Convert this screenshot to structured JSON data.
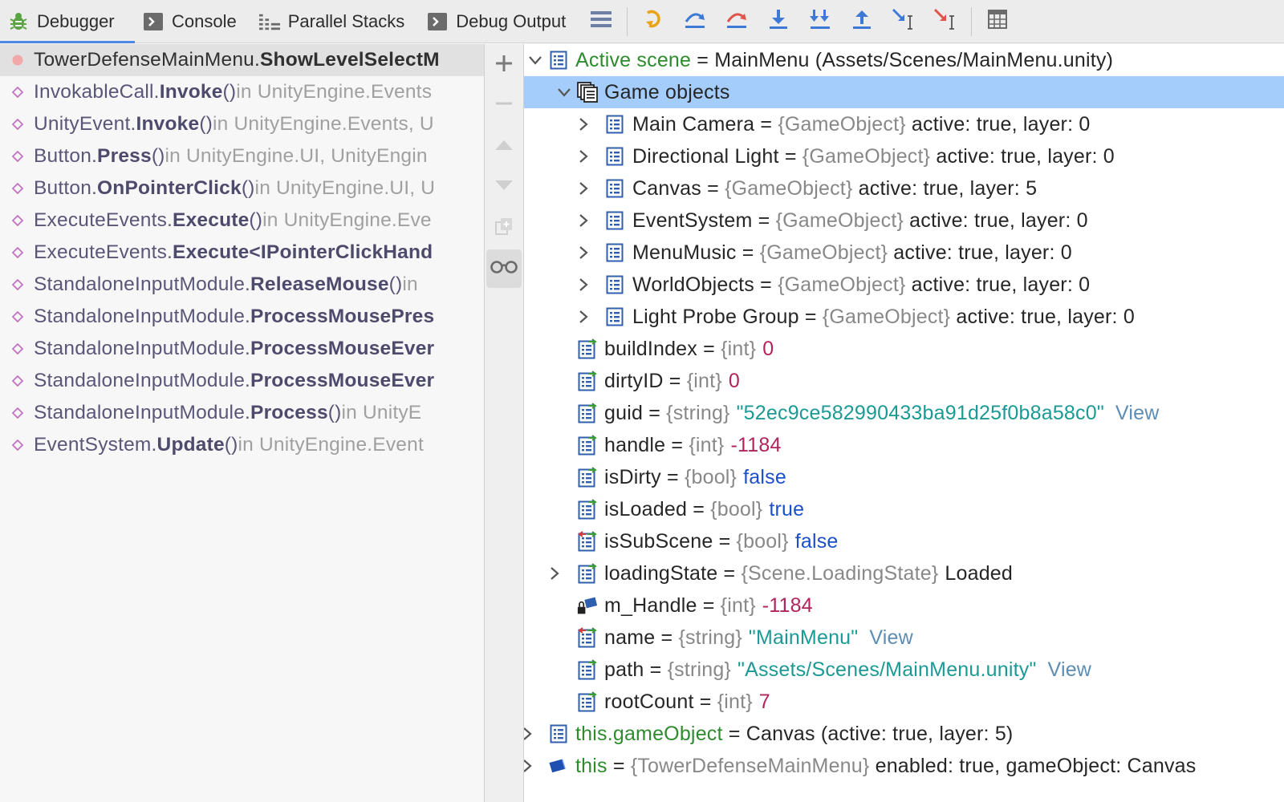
{
  "toolbar": {
    "tabs": [
      {
        "label": "Debugger",
        "icon": "bug-icon"
      },
      {
        "label": "Console",
        "icon": "console-icon"
      },
      {
        "label": "Parallel Stacks",
        "icon": "parallel-stacks-icon"
      },
      {
        "label": "Debug Output",
        "icon": "debug-output-icon"
      }
    ],
    "actions": [
      "menu-icon",
      "show-execution-point-icon",
      "step-over-icon",
      "force-step-over-icon",
      "step-into-icon",
      "force-step-into-icon",
      "step-out-icon",
      "run-to-cursor-icon",
      "force-run-to-cursor-icon",
      "evaluate-expression-icon"
    ],
    "colors": {
      "accent": "#4a88e4",
      "green": "#5aa342"
    }
  },
  "frames": [
    {
      "cls": "TowerDefenseMainMenu.",
      "meth": "ShowLevelSelectM",
      "loc": ""
    },
    {
      "cls": "InvokableCall.",
      "meth": "Invoke",
      "args": "()",
      "loc": " in UnityEngine.Events"
    },
    {
      "cls": "UnityEvent.",
      "meth": "Invoke",
      "args": "()",
      "loc": " in UnityEngine.Events, U"
    },
    {
      "cls": "Button.",
      "meth": "Press",
      "args": "()",
      "loc": " in UnityEngine.UI, UnityEngin"
    },
    {
      "cls": "Button.",
      "meth": "OnPointerClick",
      "args": "()",
      "loc": " in UnityEngine.UI, U"
    },
    {
      "cls": "ExecuteEvents.",
      "meth": "Execute",
      "args": "()",
      "loc": " in UnityEngine.Eve"
    },
    {
      "cls": "ExecuteEvents.",
      "meth": "Execute<IPointerClickHand",
      "args": "",
      "loc": ""
    },
    {
      "cls": "StandaloneInputModule.",
      "meth": "ReleaseMouse",
      "args": "()",
      "loc": " in"
    },
    {
      "cls": "StandaloneInputModule.",
      "meth": "ProcessMousePres",
      "args": "",
      "loc": ""
    },
    {
      "cls": "StandaloneInputModule.",
      "meth": "ProcessMouseEver",
      "args": "",
      "loc": ""
    },
    {
      "cls": "StandaloneInputModule.",
      "meth": "ProcessMouseEver",
      "args": "",
      "loc": ""
    },
    {
      "cls": "StandaloneInputModule.",
      "meth": "Process",
      "args": "()",
      "loc": " in UnityE"
    },
    {
      "cls": "EventSystem.",
      "meth": "Update",
      "args": "()",
      "loc": " in UnityEngine.Event"
    }
  ],
  "variables": {
    "scene": {
      "name": "Active scene",
      "eq": " = ",
      "value": "MainMenu (Assets/Scenes/MainMenu.unity)"
    },
    "game_objects_label": "Game objects",
    "game_objects": [
      {
        "name": "Main Camera",
        "type": "{GameObject}",
        "value": " active: true, layer: 0"
      },
      {
        "name": "Directional Light",
        "type": "{GameObject}",
        "value": " active: true, layer: 0"
      },
      {
        "name": "Canvas",
        "type": "{GameObject}",
        "value": " active: true, layer: 5"
      },
      {
        "name": "EventSystem",
        "type": "{GameObject}",
        "value": " active: true, layer: 0"
      },
      {
        "name": "MenuMusic",
        "type": "{GameObject}",
        "value": " active: true, layer: 0"
      },
      {
        "name": "WorldObjects",
        "type": "{GameObject}",
        "value": " active: true, layer: 0"
      },
      {
        "name": "Light Probe Group",
        "type": "{GameObject}",
        "value": " active: true, layer: 0"
      }
    ],
    "fields": [
      {
        "name": "buildIndex",
        "type": "{int}",
        "value": "0",
        "kind": "num",
        "icon": "property-icon"
      },
      {
        "name": "dirtyID",
        "type": "{int}",
        "value": "0",
        "kind": "num",
        "icon": "property-icon"
      },
      {
        "name": "guid",
        "type": "{string}",
        "value": "\"52ec9ce582990433ba91d25f0b8a58c0\"",
        "kind": "str",
        "view": "View",
        "icon": "property-icon"
      },
      {
        "name": "handle",
        "type": "{int}",
        "value": "-1184",
        "kind": "num",
        "icon": "property-icon"
      },
      {
        "name": "isDirty",
        "type": "{bool}",
        "value": "false",
        "kind": "kw",
        "icon": "property-icon"
      },
      {
        "name": "isLoaded",
        "type": "{bool}",
        "value": "true",
        "kind": "kw",
        "icon": "property-icon"
      },
      {
        "name": "isSubScene",
        "type": "{bool}",
        "value": "false",
        "kind": "kw",
        "icon": "property-rw-icon"
      },
      {
        "name": "loadingState",
        "type": "{Scene.LoadingState}",
        "value": "Loaded",
        "kind": "plain",
        "expandable": true,
        "icon": "property-icon"
      },
      {
        "name": "m_Handle",
        "type": "{int}",
        "value": "-1184",
        "kind": "num",
        "icon": "private-field-icon"
      },
      {
        "name": "name",
        "type": "{string}",
        "value": "\"MainMenu\"",
        "kind": "str",
        "view": "View",
        "icon": "property-rw-icon"
      },
      {
        "name": "path",
        "type": "{string}",
        "value": "\"Assets/Scenes/MainMenu.unity\"",
        "kind": "str",
        "view": "View",
        "icon": "property-icon"
      },
      {
        "name": "rootCount",
        "type": "{int}",
        "value": "7",
        "kind": "num",
        "icon": "property-icon"
      }
    ],
    "game_object": {
      "name": "this.gameObject",
      "eq": " = ",
      "value": "Canvas (active: true, layer: 5)"
    },
    "this": {
      "name": "this",
      "eq": " = ",
      "type": "{TowerDefenseMainMenu}",
      "value": " enabled: true, gameObject: Canvas"
    }
  }
}
